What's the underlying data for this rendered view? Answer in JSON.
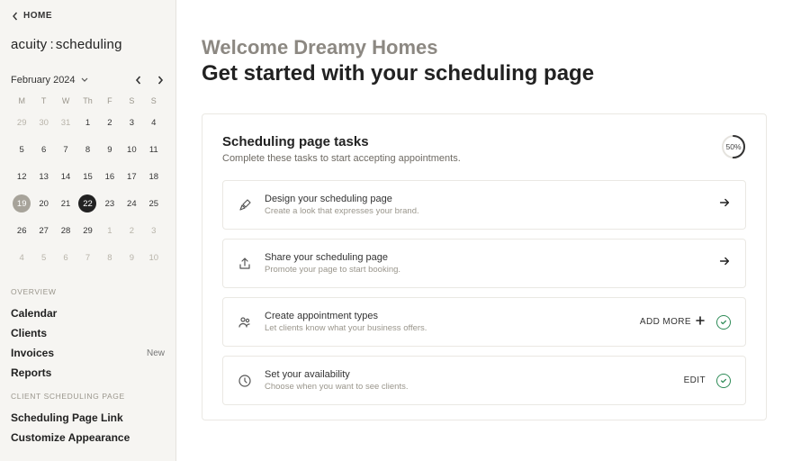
{
  "home_label": "HOME",
  "brand_a": "acuity",
  "brand_b": "scheduling",
  "calendar": {
    "month_label": "February 2024",
    "dow": [
      "M",
      "T",
      "W",
      "Th",
      "F",
      "S",
      "S"
    ],
    "weeks": [
      [
        {
          "n": "29",
          "dim": true
        },
        {
          "n": "30",
          "dim": true
        },
        {
          "n": "31",
          "dim": true
        },
        {
          "n": "1"
        },
        {
          "n": "2"
        },
        {
          "n": "3"
        },
        {
          "n": "4"
        }
      ],
      [
        {
          "n": "5"
        },
        {
          "n": "6"
        },
        {
          "n": "7"
        },
        {
          "n": "8"
        },
        {
          "n": "9"
        },
        {
          "n": "10"
        },
        {
          "n": "11"
        }
      ],
      [
        {
          "n": "12"
        },
        {
          "n": "13"
        },
        {
          "n": "14"
        },
        {
          "n": "15"
        },
        {
          "n": "16"
        },
        {
          "n": "17"
        },
        {
          "n": "18"
        }
      ],
      [
        {
          "n": "19",
          "today": true
        },
        {
          "n": "20"
        },
        {
          "n": "21"
        },
        {
          "n": "22",
          "sel": true
        },
        {
          "n": "23"
        },
        {
          "n": "24"
        },
        {
          "n": "25"
        }
      ],
      [
        {
          "n": "26"
        },
        {
          "n": "27"
        },
        {
          "n": "28"
        },
        {
          "n": "29"
        },
        {
          "n": "1",
          "dim": true
        },
        {
          "n": "2",
          "dim": true
        },
        {
          "n": "3",
          "dim": true
        }
      ],
      [
        {
          "n": "4",
          "dim": true
        },
        {
          "n": "5",
          "dim": true
        },
        {
          "n": "6",
          "dim": true
        },
        {
          "n": "7",
          "dim": true
        },
        {
          "n": "8",
          "dim": true
        },
        {
          "n": "9",
          "dim": true
        },
        {
          "n": "10",
          "dim": true
        }
      ]
    ]
  },
  "overview_label": "OVERVIEW",
  "nav_overview": [
    {
      "label": "Calendar"
    },
    {
      "label": "Clients"
    },
    {
      "label": "Invoices",
      "badge": "New"
    },
    {
      "label": "Reports"
    }
  ],
  "csp_label": "CLIENT SCHEDULING PAGE",
  "nav_csp": [
    {
      "label": "Scheduling Page Link"
    },
    {
      "label": "Customize Appearance"
    }
  ],
  "main": {
    "welcome": "Welcome Dreamy Homes",
    "headline": "Get started with your scheduling page",
    "tasks_title": "Scheduling page tasks",
    "tasks_sub": "Complete these tasks to start accepting appointments.",
    "progress_pct": "50%",
    "tasks": [
      {
        "icon": "brush",
        "title": "Design your scheduling page",
        "desc": "Create a look that expresses your brand.",
        "action": "arrow"
      },
      {
        "icon": "share",
        "title": "Share your scheduling page",
        "desc": "Promote your page to start booking.",
        "action": "arrow"
      },
      {
        "icon": "people",
        "title": "Create appointment types",
        "desc": "Let clients know what your business offers.",
        "action": "addmore",
        "action_label": "ADD MORE",
        "done": true
      },
      {
        "icon": "clock",
        "title": "Set your availability",
        "desc": "Choose when you want to see clients.",
        "action": "edit",
        "action_label": "EDIT",
        "done": true
      }
    ]
  }
}
